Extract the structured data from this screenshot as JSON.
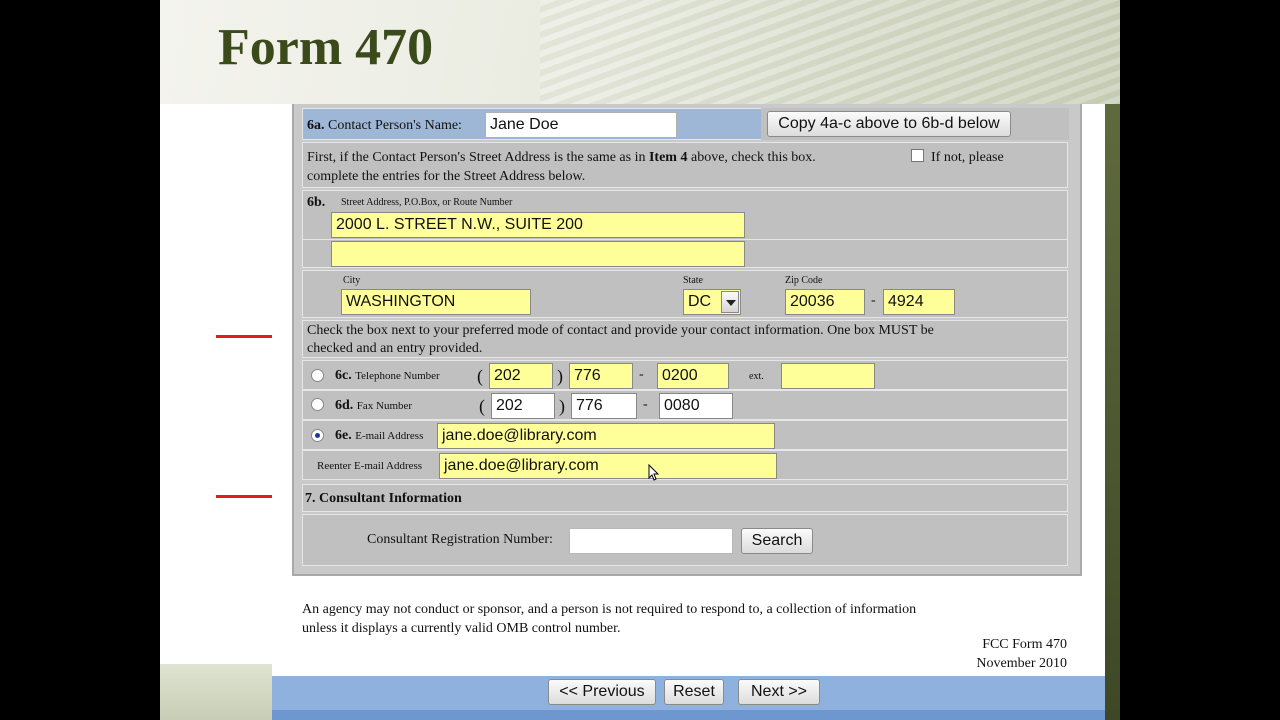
{
  "slide": {
    "title": "Form 470"
  },
  "form": {
    "contact": {
      "label_num": "6a.",
      "label": "Contact Person's Name:",
      "value": "Jane Doe",
      "copy_button": "Copy 4a-c above to 6b-d below"
    },
    "same_address": {
      "text_part1": "First, if the Contact Person's Street Address is the same as in",
      "item": "Item 4",
      "text_part2": "above, check this box.",
      "text_part3": "If not, please",
      "text_line2": "complete the entries for the Street Address below.",
      "checked": false
    },
    "street": {
      "label_num": "6b.",
      "label": "Street Address, P.O.Box, or Route Number",
      "line1": "2000 L. STREET  N.W., SUITE 200",
      "line2": ""
    },
    "city": {
      "city_label": "City",
      "city_value": "WASHINGTON",
      "state_label": "State",
      "state_value": "DC",
      "zip_label": "Zip Code",
      "zip_value": "20036",
      "zip_sep": "-",
      "zip_ext": "4924"
    },
    "mode_instructions": {
      "line1": "Check the box next to your preferred mode of contact and provide your contact information. One box MUST be",
      "line2": "checked and an entry provided."
    },
    "telephone": {
      "label_num": "6c.",
      "label": "Telephone Number",
      "open_paren": "(",
      "close_paren": ")",
      "area": "202",
      "prefix": "776",
      "dash": "-",
      "line": "0200",
      "ext_label": "ext.",
      "ext": "",
      "selected": false
    },
    "fax": {
      "label_num": "6d.",
      "label": "Fax Number",
      "open_paren": "(",
      "close_paren": ")",
      "area": "202",
      "prefix": "776",
      "dash": "-",
      "line": "0080",
      "selected": false
    },
    "email": {
      "label_num": "6e.",
      "label": "E-mail Address",
      "value": "jane.doe@library.com",
      "selected": true,
      "reenter_label": "Reenter E-mail Address",
      "reenter_value": "jane.doe@library.com"
    },
    "consultant": {
      "heading": "7. Consultant Information",
      "reg_label": "Consultant Registration Number:",
      "reg_value": "",
      "search_button": "Search"
    }
  },
  "notice": {
    "line1": "An agency may not conduct or sponsor, and a person is not required to respond to, a collection of information",
    "line2": "unless it displays a currently valid OMB control number."
  },
  "footer": {
    "form_name": "FCC Form 470",
    "date": "November 2010"
  },
  "nav": {
    "previous": "<< Previous",
    "reset": "Reset",
    "next": "Next >>"
  },
  "colors": {
    "field_yellow": "#ffff99",
    "row_gray": "#c0c0c0",
    "row_blue": "#9fb7d6",
    "arrow_red": "#e31c1c",
    "title_green": "#3a4a1a",
    "nav_blue": "#8fb1de"
  }
}
